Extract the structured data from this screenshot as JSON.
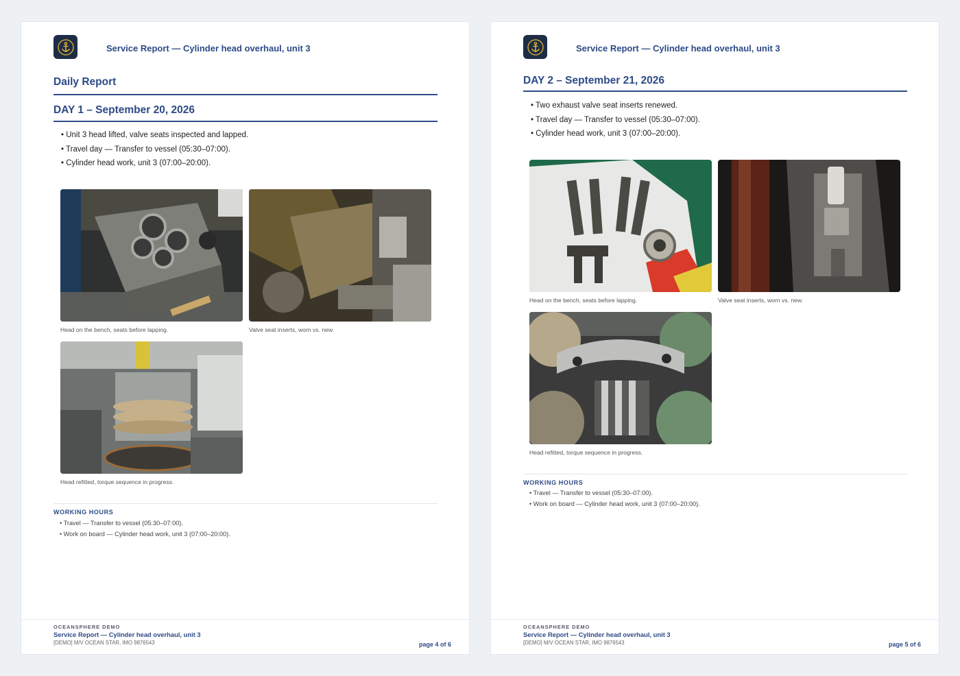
{
  "pages": [
    {
      "header_title": "Service Report — Cylinder head overhaul, unit 3",
      "section_heading": "Daily Report",
      "day_heading": "DAY 1 – September 20, 2026",
      "bullets": [
        "Unit 3 head lifted, valve seats inspected and lapped.",
        "Travel day — Transfer to vessel (05:30–07:00).",
        "Cylinder head work, unit 3 (07:00–20:00)."
      ],
      "photos": [
        {
          "caption": "Head on the bench, seats before lapping."
        },
        {
          "caption": "Valve seat inserts, worn vs. new."
        },
        {
          "caption": "Head refitted, torque sequence in progress."
        }
      ],
      "working_hours_title": "WORKING HOURS",
      "working_hours": [
        "Travel — Transfer to vessel (05:30–07:00).",
        "Work on board — Cylinder head work, unit 3 (07:00–20:00)."
      ],
      "footer": {
        "company": "OCEANSPHERE DEMO",
        "title": "Service Report — Cylinder head overhaul, unit 3",
        "vessel": "[DEMO] M/V OCEAN STAR, IMO 9876543",
        "page": "page 4 of 6"
      }
    },
    {
      "header_title": "Service Report — Cylinder head overhaul, unit 3",
      "day_heading": "DAY 2 – September 21, 2026",
      "bullets": [
        "Two exhaust valve seat inserts renewed.",
        "Travel day — Transfer to vessel (05:30–07:00).",
        "Cylinder head work, unit 3 (07:00–20:00)."
      ],
      "photos": [
        {
          "caption": "Head on the bench, seats before lapping."
        },
        {
          "caption": "Valve seat inserts, worn vs. new."
        },
        {
          "caption": "Head refitted, torque sequence in progress."
        }
      ],
      "working_hours_title": "WORKING HOURS",
      "working_hours": [
        "Travel — Transfer to vessel (05:30–07:00).",
        "Work on board — Cylinder head work, unit 3 (07:00–20:00)."
      ],
      "footer": {
        "company": "OCEANSPHERE DEMO",
        "title": "Service Report — Cylinder head overhaul, unit 3",
        "vessel": "[DEMO] M/V OCEAN STAR, IMO 9876543",
        "page": "page 5 of 6"
      }
    }
  ],
  "icons": {
    "logo": "anchor-icon"
  },
  "colors": {
    "accent": "#2d4a86",
    "logo_bg": "#1e2d45",
    "logo_fg": "#e5b534"
  }
}
